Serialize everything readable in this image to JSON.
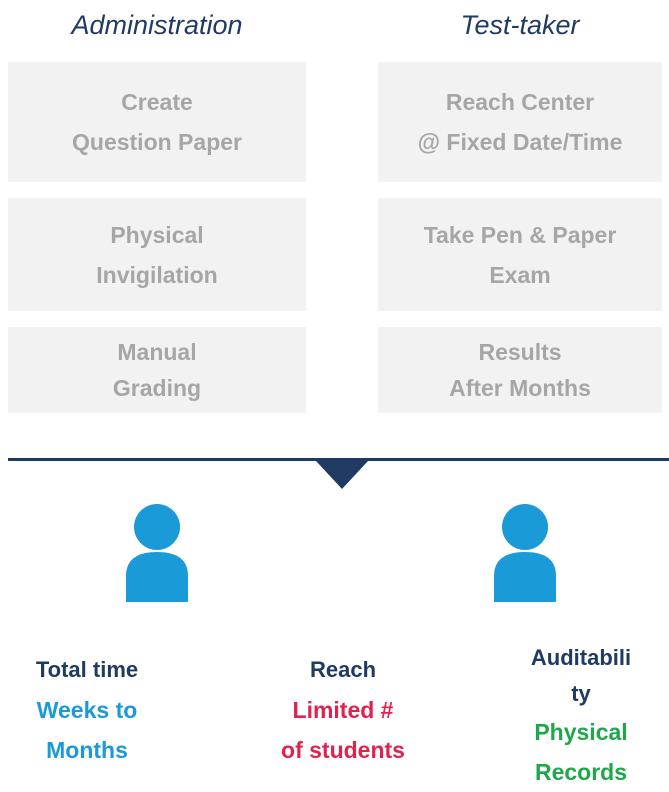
{
  "headers": {
    "administration": "Administration",
    "test_taker": "Test-taker"
  },
  "steps": {
    "administration": [
      {
        "line1": "Create",
        "line2": "Question Paper"
      },
      {
        "line1": "Physical",
        "line2": "Invigilation"
      },
      {
        "line1": "Manual",
        "line2": "Grading"
      }
    ],
    "test_taker": [
      {
        "line1": "Reach Center",
        "line2": "@ Fixed Date/Time"
      },
      {
        "line1": "Take Pen & Paper",
        "line2": "Exam"
      },
      {
        "line1": "Results",
        "line2": "After Months"
      }
    ]
  },
  "metrics": {
    "total_time": {
      "label": "Total time",
      "value_line1": "Weeks to",
      "value_line2": "Months",
      "color": "#1a9ad6"
    },
    "reach": {
      "label": "Reach",
      "value_line1": "Limited #",
      "value_line2": "of students",
      "color": "#e0234e"
    },
    "auditability": {
      "label_line1": "Auditabili",
      "label_line2": "ty",
      "value_line1": "Physical",
      "value_line2": "Records",
      "color": "#1fa84a"
    }
  },
  "icons": {
    "left": "person-icon",
    "right": "person-icon"
  },
  "colors": {
    "navy": "#1f3b63",
    "box_background": "#f2f2f2",
    "box_text": "#a6a6a6",
    "person_icon": "#1a9ad6"
  }
}
